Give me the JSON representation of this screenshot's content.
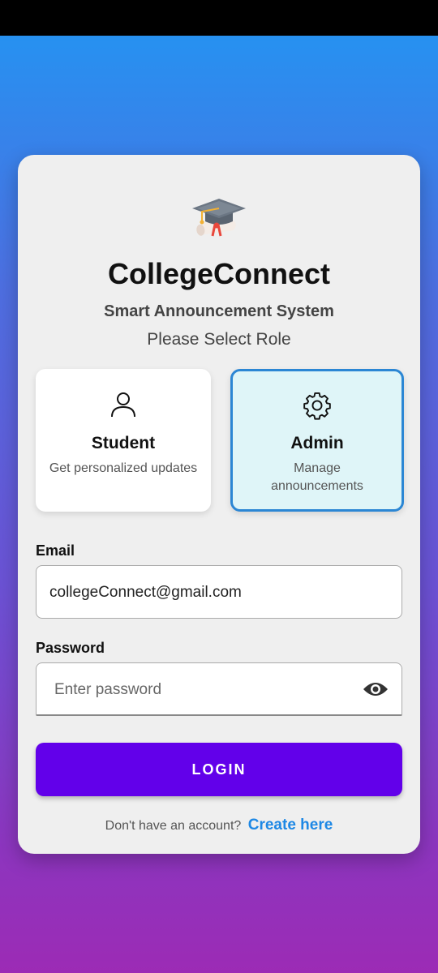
{
  "header": {
    "logo_icon": "graduation-cap-icon",
    "title": "CollegeConnect",
    "subtitle": "Smart Announcement System",
    "role_prompt": "Please Select Role"
  },
  "roles": [
    {
      "name": "Student",
      "description": "Get personalized updates",
      "icon": "user-icon",
      "selected": false
    },
    {
      "name": "Admin",
      "description": "Manage announcements",
      "icon": "gear-icon",
      "selected": true
    }
  ],
  "form": {
    "email_label": "Email",
    "email_value": "collegeConnect@gmail.com",
    "password_label": "Password",
    "password_placeholder": "Enter password",
    "password_toggle_icon": "eye-icon",
    "login_label": "LOGIN"
  },
  "footer": {
    "prompt": "Don't have an account?",
    "link": "Create here"
  },
  "colors": {
    "primary": "#6200ea",
    "link": "#1e88e5",
    "selected_border": "#2b86d4",
    "selected_bg": "#dff5f8",
    "gradient_top": "#2196f3",
    "gradient_bottom": "#9c2bb5"
  }
}
